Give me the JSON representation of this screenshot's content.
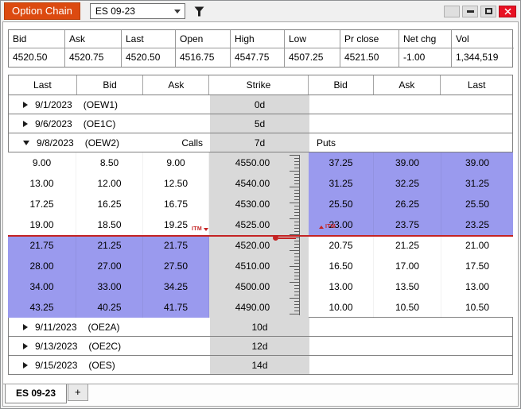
{
  "window": {
    "title": "Option Chain",
    "symbol": "ES 09-23"
  },
  "quote": {
    "headers": [
      "Bid",
      "Ask",
      "Last",
      "Open",
      "High",
      "Low",
      "Pr close",
      "Net chg",
      "Vol"
    ],
    "values": [
      "4520.50",
      "4520.75",
      "4520.50",
      "4516.75",
      "4547.75",
      "4507.25",
      "4521.50",
      "-1.00",
      "1,344,519"
    ]
  },
  "chain": {
    "headers": [
      "Last",
      "Bid",
      "Ask",
      "Strike",
      "Bid",
      "Ask",
      "Last"
    ],
    "calls_label": "Calls",
    "puts_label": "Puts",
    "itm_label": "ITM",
    "groups_top": [
      {
        "date": "9/1/2023",
        "code": "(OEW1)",
        "days": "0d"
      },
      {
        "date": "9/6/2023",
        "code": "(OE1C)",
        "days": "5d"
      }
    ],
    "expanded_group": {
      "date": "9/8/2023",
      "code": "(OEW2)",
      "days": "7d"
    },
    "rows": [
      {
        "call_last": "9.00",
        "call_bid": "8.50",
        "call_ask": "9.00",
        "strike": "4550.00",
        "put_bid": "37.25",
        "put_ask": "39.00",
        "put_last": "39.00",
        "call_itm": false,
        "put_itm": true
      },
      {
        "call_last": "13.00",
        "call_bid": "12.00",
        "call_ask": "12.50",
        "strike": "4540.00",
        "put_bid": "31.25",
        "put_ask": "32.25",
        "put_last": "31.25",
        "call_itm": false,
        "put_itm": true
      },
      {
        "call_last": "17.25",
        "call_bid": "16.25",
        "call_ask": "16.75",
        "strike": "4530.00",
        "put_bid": "25.50",
        "put_ask": "26.25",
        "put_last": "25.50",
        "call_itm": false,
        "put_itm": true
      },
      {
        "call_last": "19.00",
        "call_bid": "18.50",
        "call_ask": "19.25",
        "strike": "4525.00",
        "put_bid": "23.00",
        "put_ask": "23.75",
        "put_last": "23.25",
        "call_itm": false,
        "put_itm": true
      },
      {
        "call_last": "21.75",
        "call_bid": "21.25",
        "call_ask": "21.75",
        "strike": "4520.00",
        "put_bid": "20.75",
        "put_ask": "21.25",
        "put_last": "21.00",
        "call_itm": true,
        "put_itm": false
      },
      {
        "call_last": "28.00",
        "call_bid": "27.00",
        "call_ask": "27.50",
        "strike": "4510.00",
        "put_bid": "16.50",
        "put_ask": "17.00",
        "put_last": "17.50",
        "call_itm": true,
        "put_itm": false
      },
      {
        "call_last": "34.00",
        "call_bid": "33.00",
        "call_ask": "34.25",
        "strike": "4500.00",
        "put_bid": "13.00",
        "put_ask": "13.50",
        "put_last": "13.00",
        "call_itm": true,
        "put_itm": false
      },
      {
        "call_last": "43.25",
        "call_bid": "40.25",
        "call_ask": "41.75",
        "strike": "4490.00",
        "put_bid": "10.00",
        "put_ask": "10.50",
        "put_last": "10.50",
        "call_itm": true,
        "put_itm": false
      }
    ],
    "groups_bottom": [
      {
        "date": "9/11/2023",
        "code": "(OE2A)",
        "days": "10d"
      },
      {
        "date": "9/13/2023",
        "code": "(OE2C)",
        "days": "12d"
      },
      {
        "date": "9/15/2023",
        "code": "(OES)",
        "days": "14d"
      }
    ]
  },
  "tabs": {
    "active": "ES 09-23",
    "add_label": "+"
  },
  "colors": {
    "itm_highlight": "#9a9aee",
    "price_line": "#c42323",
    "title_badge": "#dc4a10",
    "close_button": "#e81123",
    "strike_column": "#d9d9d9"
  }
}
